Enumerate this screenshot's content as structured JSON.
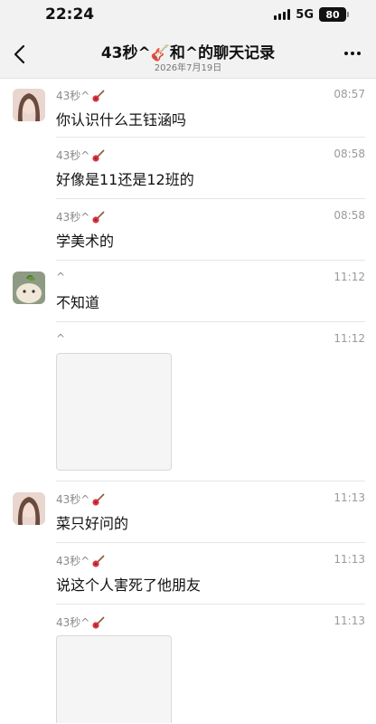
{
  "status_bar": {
    "time": "22:24",
    "network": "5G",
    "battery": "80"
  },
  "header": {
    "title": "43秒^🎸和^的聊天记录",
    "subtitle": "2026年7月19日"
  },
  "messages": [
    {
      "sender": "43秒^",
      "time": "08:57",
      "text": "你认识什么王钰涵吗"
    },
    {
      "sender": "43秒^",
      "time": "08:58",
      "text": "好像是11还是12班的"
    },
    {
      "sender": "43秒^",
      "time": "08:58",
      "text": "学美术的"
    },
    {
      "sender": "^",
      "time": "11:12",
      "text": "不知道"
    },
    {
      "sender": "^",
      "time": "11:12",
      "text": ""
    },
    {
      "sender": "43秒^",
      "time": "11:13",
      "text": "菜只好问的"
    },
    {
      "sender": "43秒^",
      "time": "11:13",
      "text": "说这个人害死了他朋友"
    },
    {
      "sender": "43秒^",
      "time": "11:13",
      "text": ""
    }
  ]
}
